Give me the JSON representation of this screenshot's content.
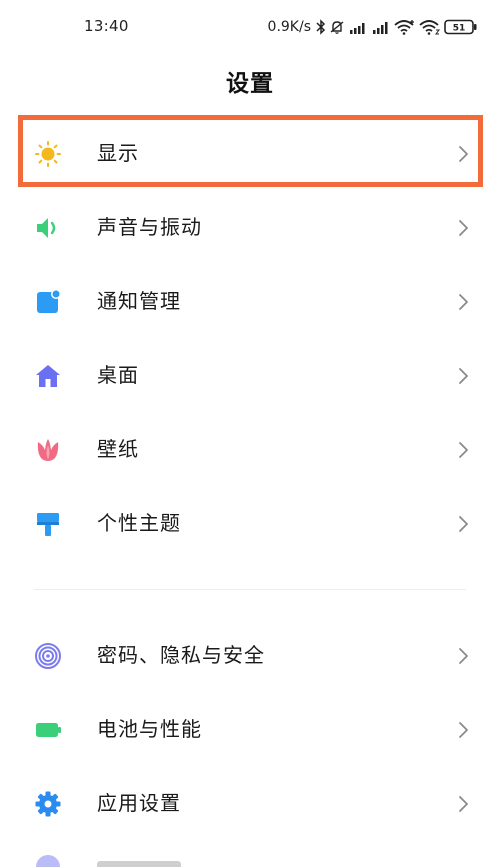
{
  "status_bar": {
    "time": "13:40",
    "net_speed": "0.9K/s",
    "battery_level": "51"
  },
  "header": {
    "title": "设置"
  },
  "items": [
    {
      "label": "显示",
      "icon": "sun-icon",
      "color": "#f5b81c"
    },
    {
      "label": "声音与振动",
      "icon": "speaker-icon",
      "color": "#3ccf7a"
    },
    {
      "label": "通知管理",
      "icon": "notification-icon",
      "color": "#2b9bf4"
    },
    {
      "label": "桌面",
      "icon": "home-icon",
      "color": "#6b6ff2"
    },
    {
      "label": "壁纸",
      "icon": "tulip-icon",
      "color": "#f06a83"
    },
    {
      "label": "个性主题",
      "icon": "paint-roller-icon",
      "color": "#2b9bf4"
    },
    {
      "label": "密码、隐私与安全",
      "icon": "fingerprint-icon",
      "color": "#7c7cf0"
    },
    {
      "label": "电池与性能",
      "icon": "battery-icon",
      "color": "#3ccf7a"
    },
    {
      "label": "应用设置",
      "icon": "gear-icon",
      "color": "#2b8cf0"
    }
  ],
  "highlight": {
    "color": "#f26b3a"
  }
}
